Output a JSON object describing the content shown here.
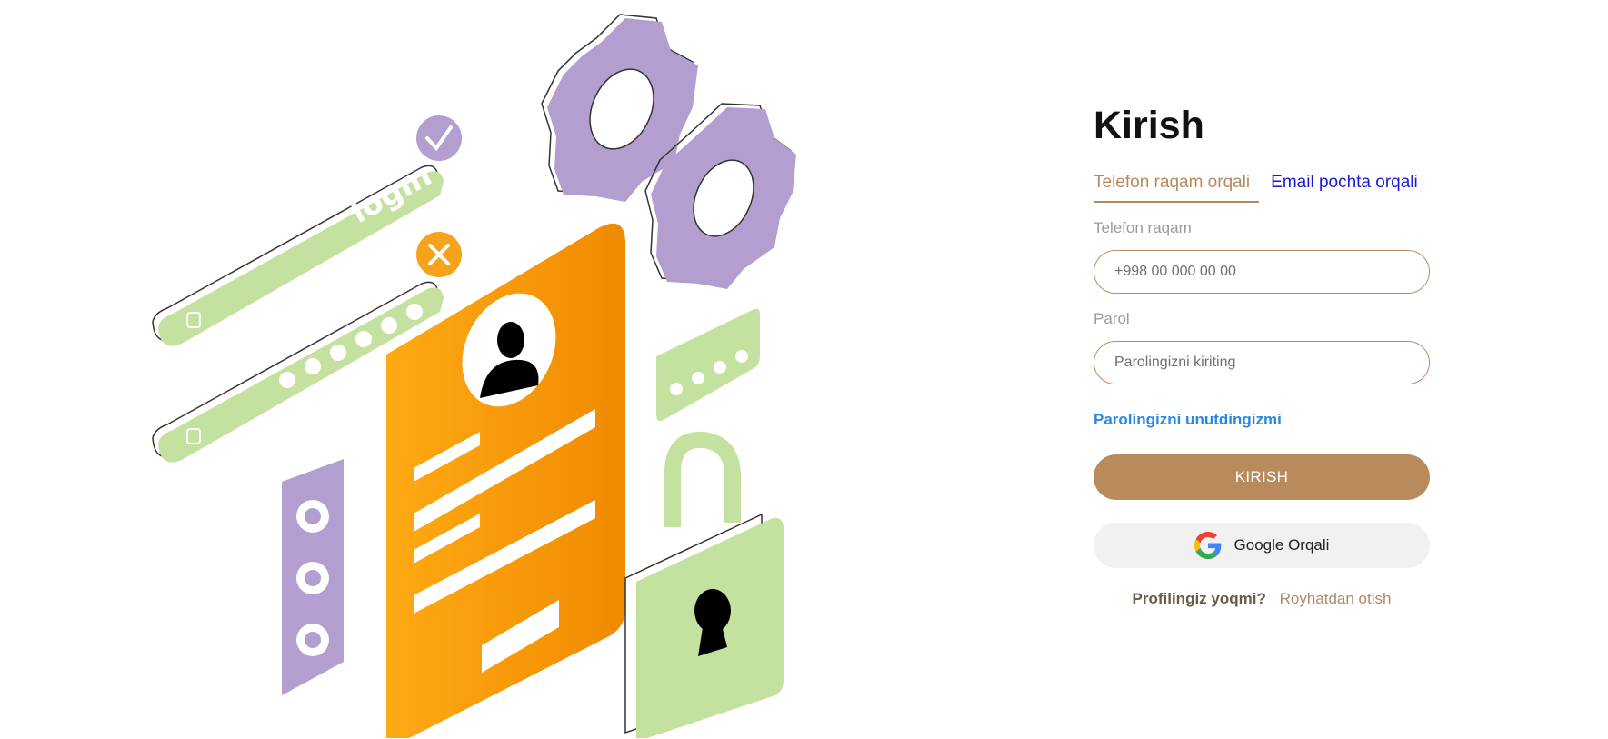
{
  "login": {
    "title": "Kirish",
    "tabs": [
      {
        "label": "Telefon raqam orqali",
        "active": true
      },
      {
        "label": "Email pochta orqali",
        "active": false
      }
    ],
    "phone_label": "Telefon raqam",
    "phone_placeholder": "+998 00 000 00 00",
    "password_label": "Parol",
    "password_placeholder": "Parolingizni kiriting",
    "forgot_password": "Parolingizni unutdingizmi",
    "submit_label": "KIRISH",
    "google_label": "Google Orqali",
    "no_profile_text": "Profilingiz yoqmi?",
    "register_link": "Royhatdan otish"
  },
  "illustration": {
    "login_text": "login"
  },
  "colors": {
    "accent": "#b98b5c",
    "tab_active": "#b78a5c",
    "tab_inactive": "#1a1ad6",
    "link": "#2b87e3",
    "illus_orange": "#f7a21b",
    "illus_green": "#c5e1a0",
    "illus_purple": "#b29ecf"
  },
  "icons": [
    "google-icon",
    "gear-icon",
    "lock-icon",
    "user-icon",
    "check-icon",
    "close-icon",
    "padlock-icon"
  ]
}
